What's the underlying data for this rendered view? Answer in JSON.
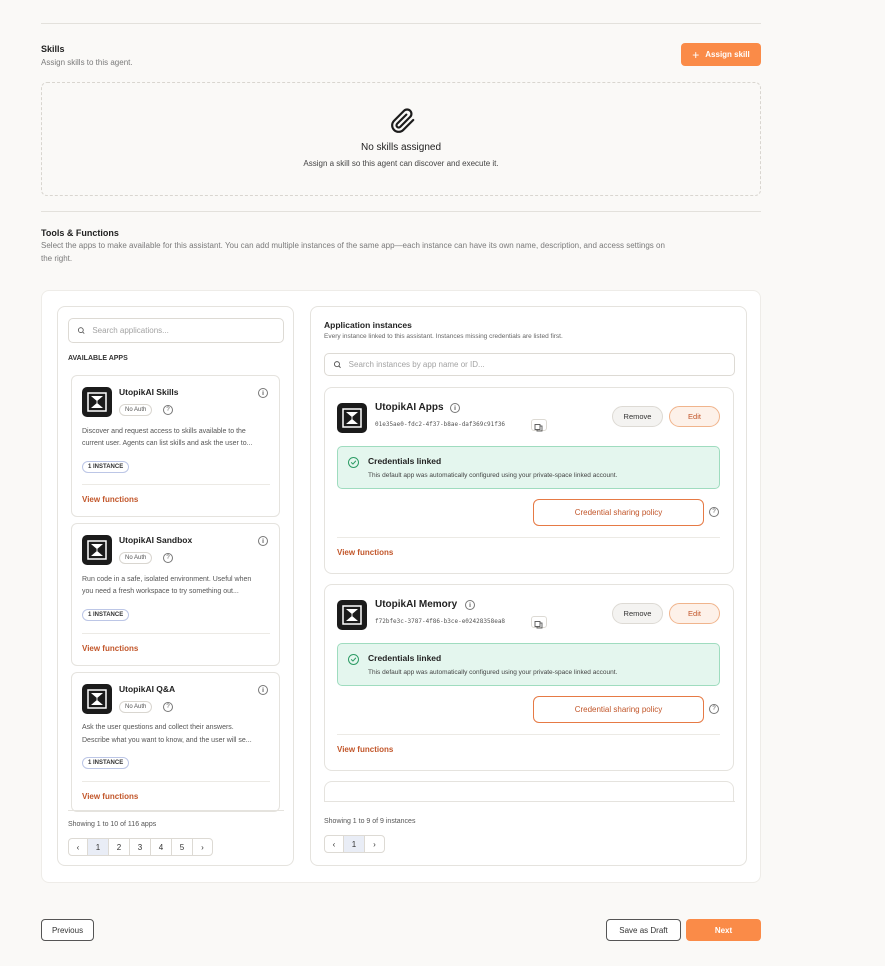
{
  "skills": {
    "title": "Skills",
    "subtitle": "Assign skills to this agent.",
    "assign_button": "Assign skill",
    "empty_title": "No skills assigned",
    "empty_subtitle": "Assign a skill so this agent can discover and execute it.",
    "empty_icon": "paperclip-icon"
  },
  "tools": {
    "title": "Tools & Functions",
    "subtitle_line1": "Select the apps to make available for this assistant. You can add multiple instances of the same app—each instance can have its own name, description, and access settings on",
    "subtitle_line2": "the right."
  },
  "apps_panel": {
    "search_placeholder": "Search applications...",
    "section_label": "AVAILABLE APPS",
    "apps": [
      {
        "name": "UtopikAI Skills",
        "auth": "No Auth",
        "desc_line1": "Discover and request access to skills available to the",
        "desc_line2": "current user. Agents can list skills and ask the user to...",
        "instances": "1 INSTANCE",
        "link": "View functions"
      },
      {
        "name": "UtopikAI Sandbox",
        "auth": "No Auth",
        "desc_line1": "Run code in a safe, isolated environment. Useful when",
        "desc_line2": "you need a fresh workspace to try something out...",
        "instances": "1 INSTANCE",
        "link": "View functions"
      },
      {
        "name": "UtopikAI Q&A",
        "auth": "No Auth",
        "desc_line1": "Ask the user questions and collect their answers.",
        "desc_line2": "Describe what you want to know, and the user will se...",
        "instances": "1 INSTANCE",
        "link": "View functions"
      }
    ],
    "showing": "Showing 1 to 10 of 116 apps",
    "pager": {
      "prev": "‹",
      "pages": [
        "1",
        "2",
        "3",
        "4",
        "5"
      ],
      "next": "›",
      "current": "1"
    }
  },
  "instances_panel": {
    "title": "Application instances",
    "subtitle": "Every instance linked to this assistant. Instances missing credentials are listed first.",
    "search_placeholder": "Search instances by app name or ID...",
    "instances": [
      {
        "name": "UtopikAI Apps",
        "id": "01e35ae0-fdc2-4f37-b8ae-daf369c91f36",
        "remove": "Remove",
        "edit": "Edit",
        "cred_title": "Credentials linked",
        "cred_sub": "This default app was automatically configured using your private-space linked account.",
        "policy": "Credential sharing policy",
        "link": "View functions"
      },
      {
        "name": "UtopikAI Memory",
        "id": "f72bfe3c-3787-4f86-b3ce-e02428358ea8",
        "remove": "Remove",
        "edit": "Edit",
        "cred_title": "Credentials linked",
        "cred_sub": "This default app was automatically configured using your private-space linked account.",
        "policy": "Credential sharing policy",
        "link": "View functions"
      }
    ],
    "showing": "Showing 1 to 9 of 9 instances",
    "pager": {
      "prev": "‹",
      "page": "1",
      "next": "›"
    }
  },
  "footer": {
    "previous": "Previous",
    "save_draft": "Save as Draft",
    "next": "Next"
  },
  "colors": {
    "accent": "#fa8b48",
    "link": "#c2562a",
    "success_bg": "#e4f6ee"
  }
}
